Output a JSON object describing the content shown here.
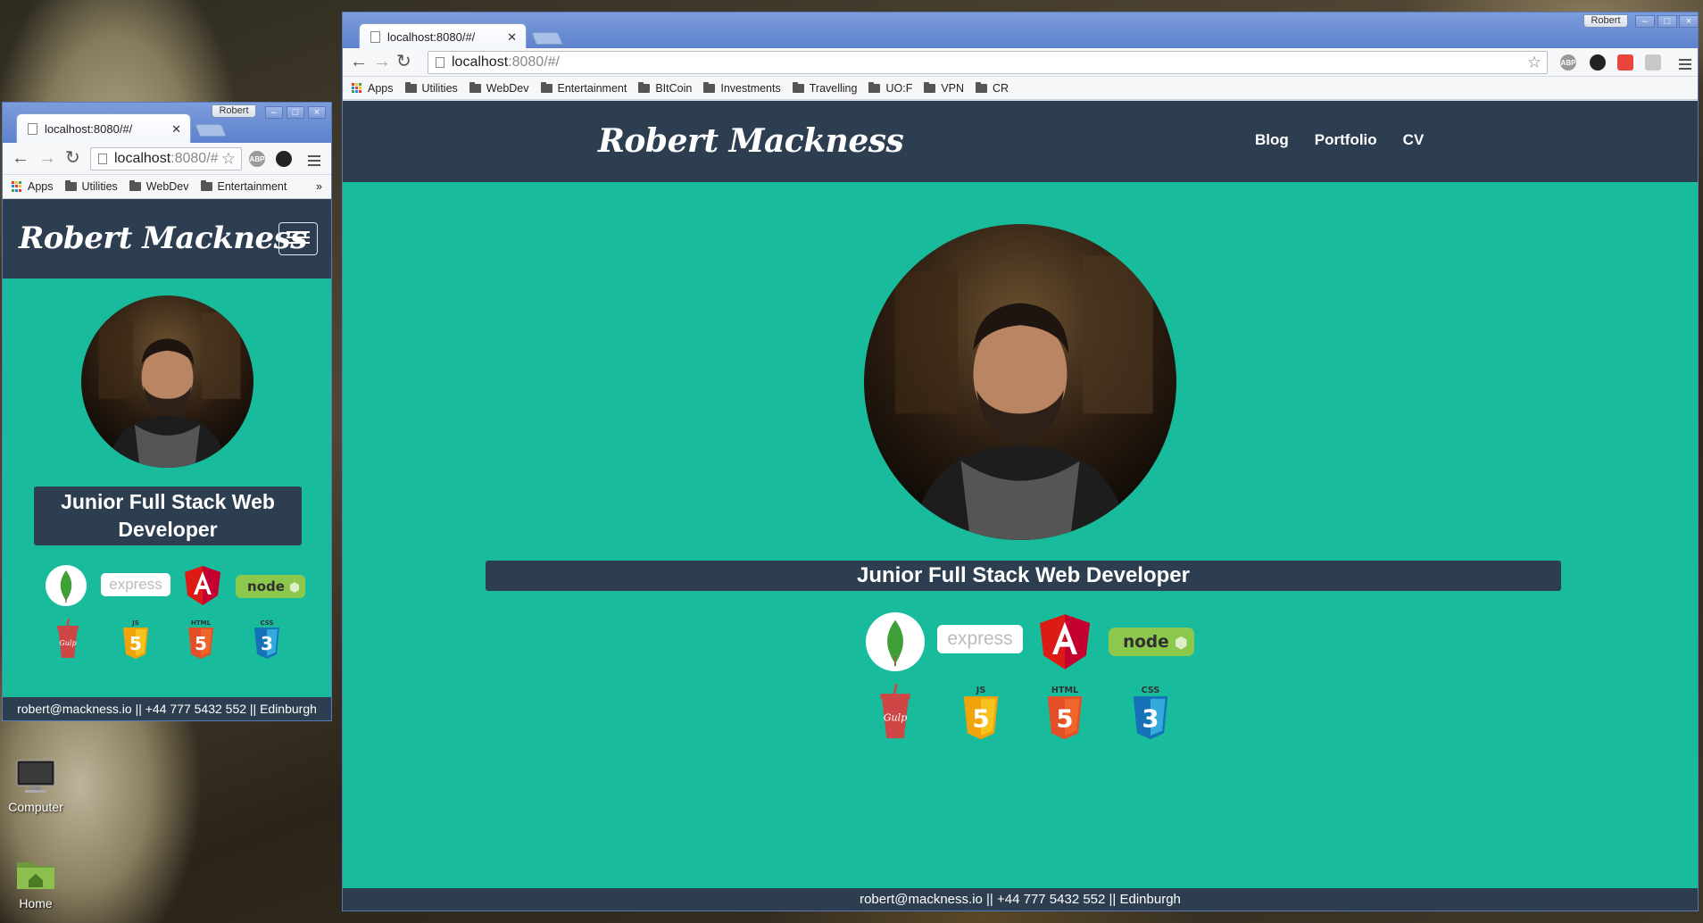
{
  "desktop": {
    "icons": [
      {
        "name": "computer",
        "label": "Computer"
      },
      {
        "name": "home",
        "label": "Home"
      }
    ]
  },
  "small_window": {
    "profile": "Robert",
    "tab_title": "localhost:8080/#/",
    "url_host": "localhost",
    "url_rest": ":8080/#",
    "bookmarks": [
      "Apps",
      "Utilities",
      "WebDev",
      "Entertainment"
    ],
    "bookmarks_more": "»"
  },
  "large_window": {
    "profile": "Robert",
    "tab_title": "localhost:8080/#/",
    "url_host": "localhost",
    "url_rest": ":8080/#/",
    "bookmarks": [
      "Apps",
      "Utilities",
      "WebDev",
      "Entertainment",
      "BItCoin",
      "Investments",
      "Travelling",
      "UO:F",
      "VPN",
      "CR"
    ]
  },
  "site": {
    "brand": "Robert Mackness",
    "nav": [
      "Blog",
      "Portfolio",
      "CV"
    ],
    "subtitle": "Junior Full Stack Web Developer",
    "logos": [
      "mongodb",
      "express",
      "angular",
      "node",
      "gulp",
      "js",
      "html5",
      "css3"
    ],
    "logo_labels": {
      "express": "express",
      "js": "JS",
      "html": "HTML",
      "css": "CSS",
      "gulp": "Gulp",
      "node": "node"
    },
    "footer": "robert@mackness.io || +44 777 5432 552 || Edinburgh"
  },
  "extensions": {
    "abp": "ABP"
  },
  "colors": {
    "primary": "#2c3e50",
    "accent": "#18bc9c"
  }
}
